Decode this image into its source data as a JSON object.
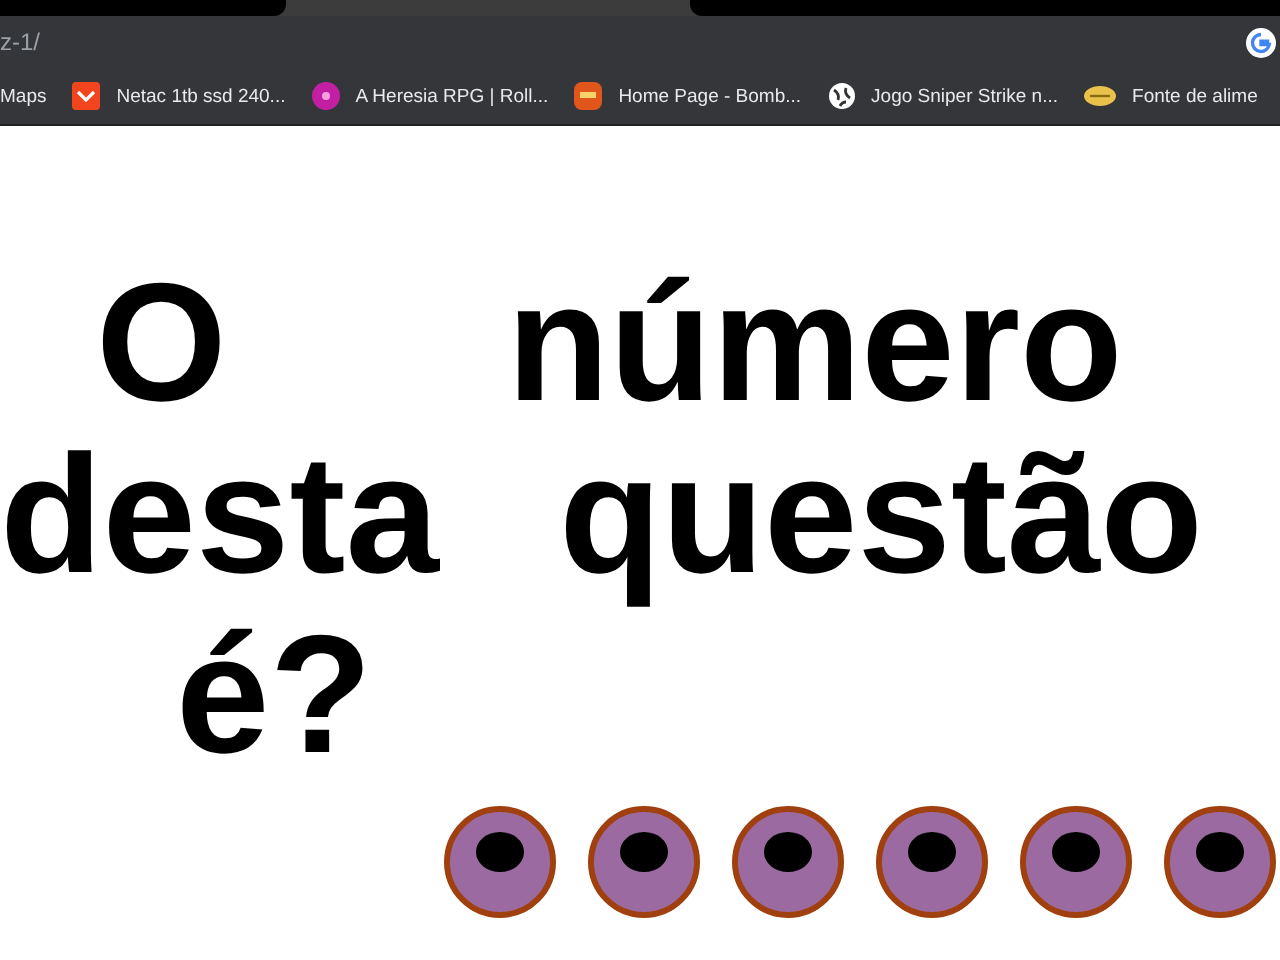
{
  "browser": {
    "address": "z-1/",
    "bookmarks": [
      {
        "label": "Maps",
        "kind": "plain"
      },
      {
        "label": "Netac 1tb ssd 240...",
        "kind": "shop"
      },
      {
        "label": "A Heresia RPG | Roll...",
        "kind": "dot"
      },
      {
        "label": "Home Page - Bomb...",
        "kind": "face"
      },
      {
        "label": "Jogo Sniper Strike n...",
        "kind": "globe"
      },
      {
        "label": "Fonte de alime",
        "kind": "oval"
      }
    ]
  },
  "question": {
    "lines": [
      [
        "O",
        "número"
      ],
      [
        "desta",
        "questão"
      ],
      [
        "é?"
      ]
    ]
  },
  "answer_options": [
    {
      "kind": "round"
    },
    {
      "kind": "round"
    },
    {
      "kind": "round"
    },
    {
      "kind": "round"
    },
    {
      "kind": "round"
    },
    {
      "kind": "round"
    }
  ]
}
